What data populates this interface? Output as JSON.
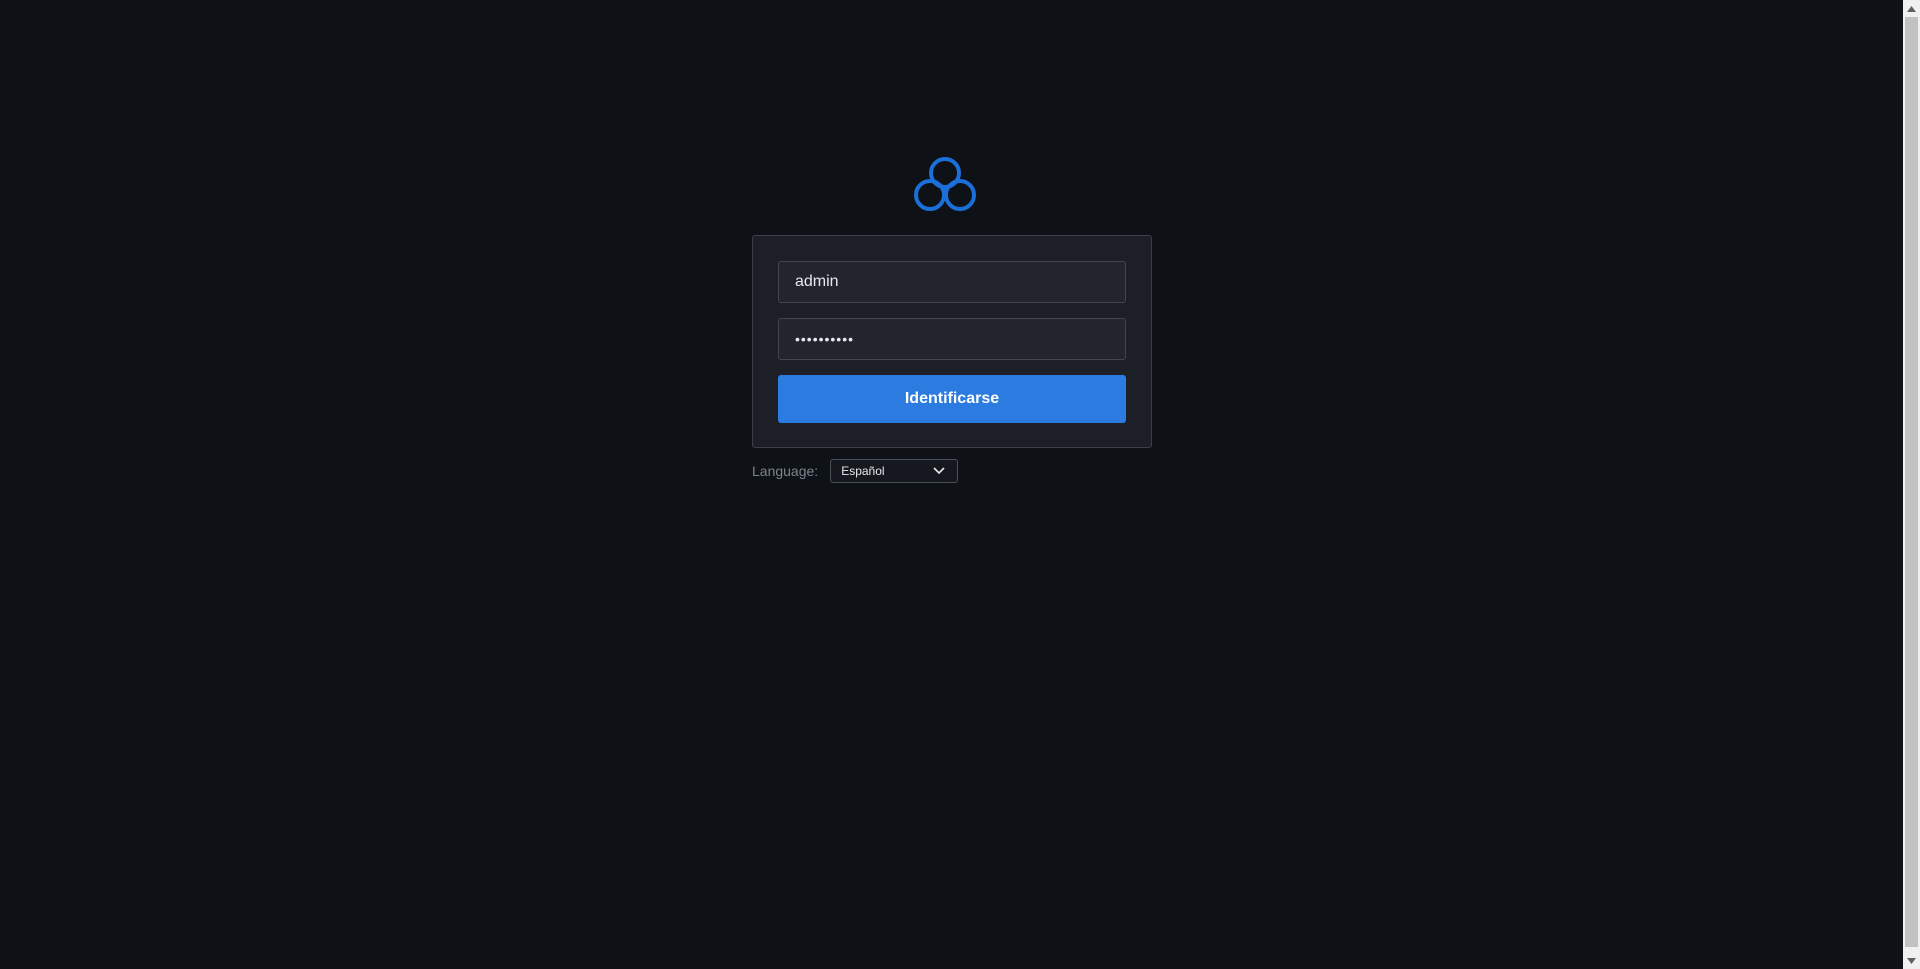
{
  "login": {
    "username_value": "admin",
    "password_value": "••••••••••",
    "submit_label": "Identificarse"
  },
  "language": {
    "label": "Language:",
    "selected": "Español"
  },
  "icons": {
    "logo": "cloud-logo-icon",
    "dropdown": "chevron-down-icon"
  },
  "colors": {
    "background": "#0e1116",
    "card": "#1c1f26",
    "accent": "#2b7be0",
    "logo": "#1a6fd8"
  }
}
